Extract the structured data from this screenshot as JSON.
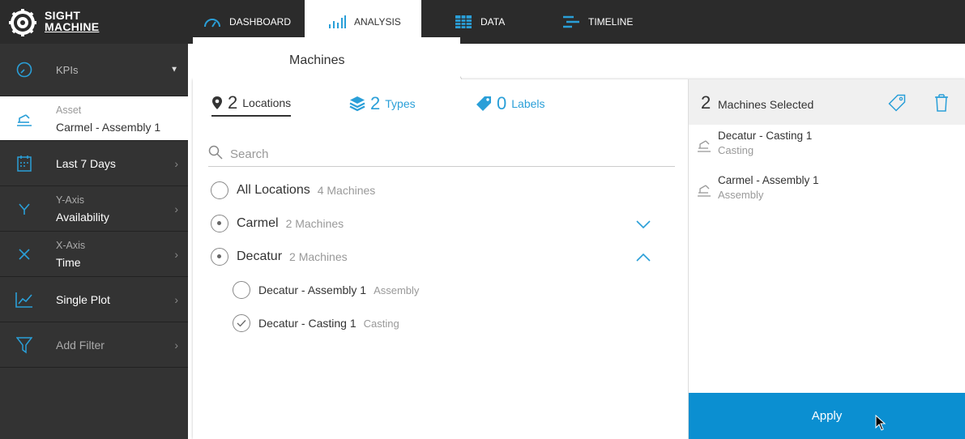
{
  "brand": {
    "line1": "SIGHT",
    "line2": "MACHINE"
  },
  "nav": {
    "dashboard": "DASHBOARD",
    "analysis": "ANALYSIS",
    "data": "DATA",
    "timeline": "TIMELINE"
  },
  "sidebar": {
    "kpis": "KPIs",
    "asset_label": "Asset",
    "asset_value": "Carmel - Assembly 1",
    "period": "Last 7 Days",
    "yaxis_label": "Y-Axis",
    "yaxis_value": "Availability",
    "xaxis_label": "X-Axis",
    "xaxis_value": "Time",
    "plot": "Single Plot",
    "filter": "Add Filter"
  },
  "panel": {
    "tab_title": "Machines",
    "filters": {
      "locations_count": "2",
      "locations_label": "Locations",
      "types_count": "2",
      "types_label": "Types",
      "labels_count": "0",
      "labels_label": "Labels"
    },
    "search_placeholder": "Search",
    "list": {
      "all": {
        "name": "All Locations",
        "count": "4 Machines"
      },
      "carmel": {
        "name": "Carmel",
        "count": "2 Machines"
      },
      "decatur": {
        "name": "Decatur",
        "count": "2 Machines"
      },
      "decatur_children": [
        {
          "name": "Decatur - Assembly 1",
          "type": "Assembly"
        },
        {
          "name": "Decatur - Casting 1",
          "type": "Casting"
        }
      ]
    }
  },
  "selected": {
    "count": "2",
    "label": "Machines Selected",
    "items": [
      {
        "name": "Decatur - Casting 1",
        "type": "Casting"
      },
      {
        "name": "Carmel - Assembly 1",
        "type": "Assembly"
      }
    ]
  },
  "apply_label": "Apply",
  "colors": {
    "accent": "#0b8fd1",
    "dark": "#333333",
    "topbar": "#2b2b2b"
  }
}
